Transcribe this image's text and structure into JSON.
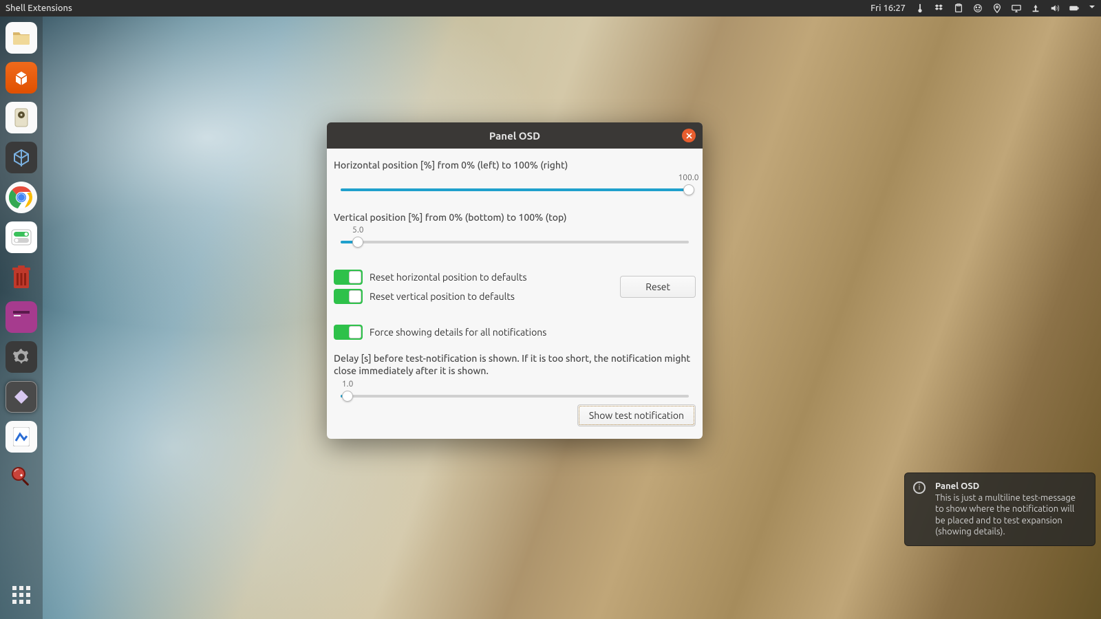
{
  "panel": {
    "title": "Shell Extensions",
    "clock": "Fri 16:27"
  },
  "dialog": {
    "title": "Panel OSD",
    "hpos": {
      "label": "Horizontal position [%] from 0% (left) to 100% (right)",
      "value_text": "100.0",
      "value": 100
    },
    "vpos": {
      "label": "Vertical position [%] from 0% (bottom) to 100% (top)",
      "value_text": "5.0",
      "value": 5
    },
    "reset_h": "Reset horizontal position to defaults",
    "reset_v": "Reset vertical position to defaults",
    "reset_btn": "Reset",
    "force_details": "Force showing details for all notifications",
    "delay": {
      "label": "Delay [s] before test-notification is shown. If it is too short, the notification might close immediately after it is shown.",
      "value_text": "1.0",
      "value": 2
    },
    "show_test": "Show test notification"
  },
  "notification": {
    "title": "Panel OSD",
    "message": "This is just a multiline test-message to show where the notification will be placed and to test expansion (showing details)."
  }
}
